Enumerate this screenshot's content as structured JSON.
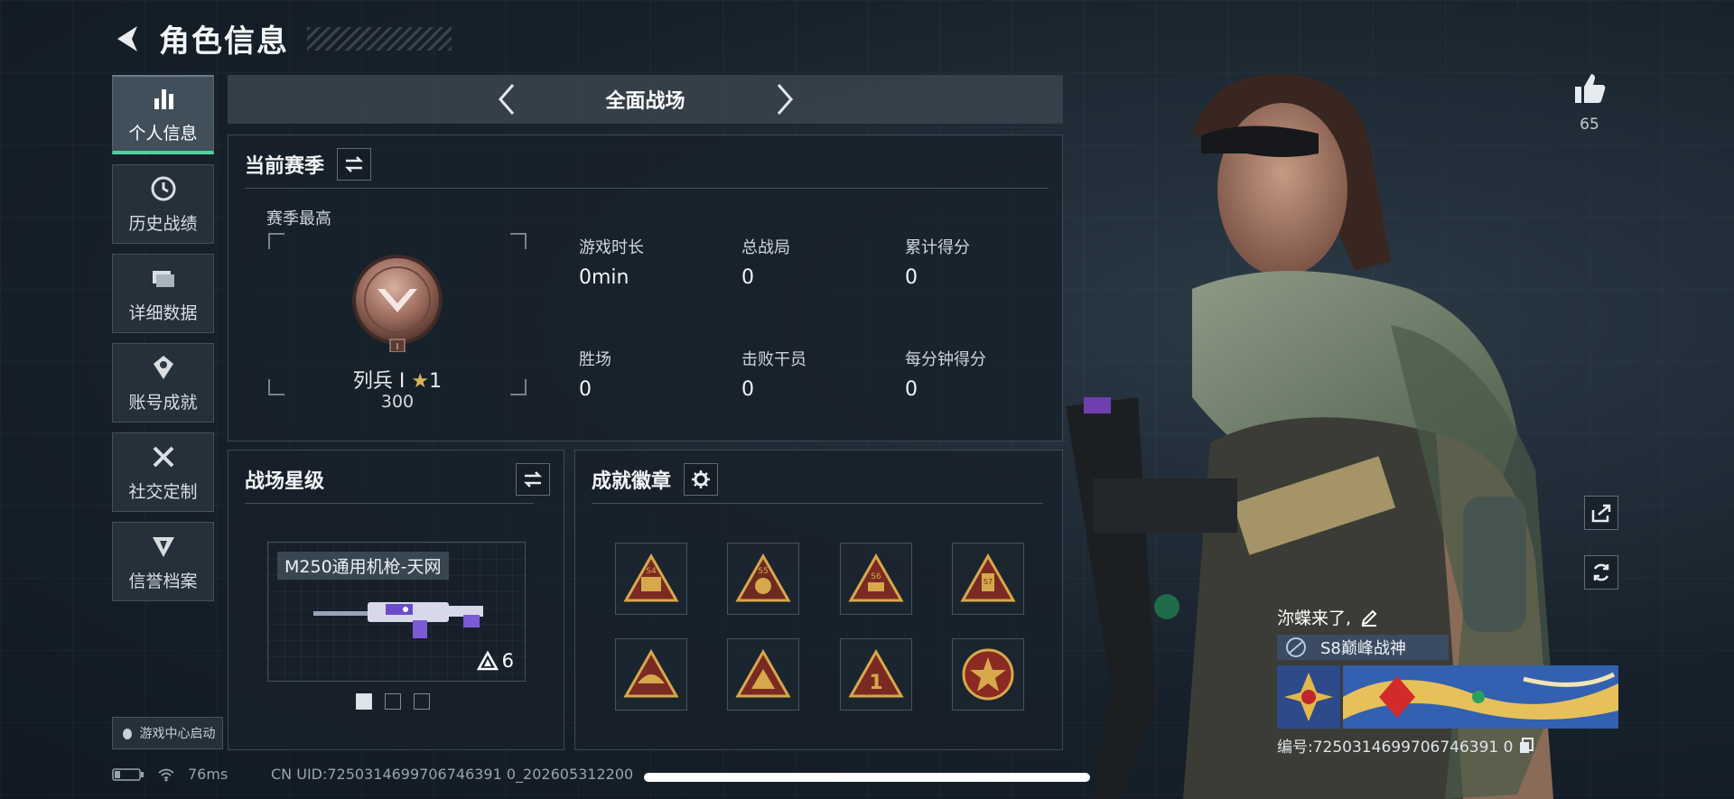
{
  "header": {
    "title": "角色信息"
  },
  "sidebar": {
    "items": [
      {
        "label": "个人信息",
        "icon": "bar-chart-icon"
      },
      {
        "label": "历史战绩",
        "icon": "history-icon"
      },
      {
        "label": "详细数据",
        "icon": "folder-icon"
      },
      {
        "label": "账号成就",
        "icon": "achievement-icon"
      },
      {
        "label": "社交定制",
        "icon": "tools-icon"
      },
      {
        "label": "信誉档案",
        "icon": "shield-icon"
      }
    ],
    "launch_label": "游戏中心启动"
  },
  "mode": {
    "title": "全面战场"
  },
  "season": {
    "title": "当前赛季",
    "best_label": "赛季最高",
    "rank_name": "列兵 Ⅰ",
    "rank_stars": "1",
    "rank_points": "300",
    "stats": [
      {
        "label": "游戏时长",
        "value": "0min"
      },
      {
        "label": "总战局",
        "value": "0"
      },
      {
        "label": "累计得分",
        "value": "0"
      },
      {
        "label": "胜场",
        "value": "0"
      },
      {
        "label": "击败干员",
        "value": "0"
      },
      {
        "label": "每分钟得分",
        "value": "0"
      }
    ]
  },
  "star_level": {
    "title": "战场星级",
    "weapon_name": "M250通用机枪-天网",
    "weapon_stars": "6",
    "page_count": 3,
    "active_page": 1
  },
  "badges": {
    "title": "成就徽章",
    "icon_labels": [
      "S4",
      "S5",
      "S6",
      "S7",
      "",
      "",
      "1",
      ""
    ]
  },
  "social": {
    "like_count": "65"
  },
  "player": {
    "name": "沵蝶来了,",
    "title": "S8巅峰战神",
    "id": "编号:7250314699706746391 0"
  },
  "status": {
    "ping": "76ms",
    "uid": "CN UID:7250314699706746391 0_202605312200"
  },
  "colors": {
    "accent": "#4fd0a0",
    "badge_gold": "#d6a84b",
    "badge_red": "#7a2a22"
  }
}
